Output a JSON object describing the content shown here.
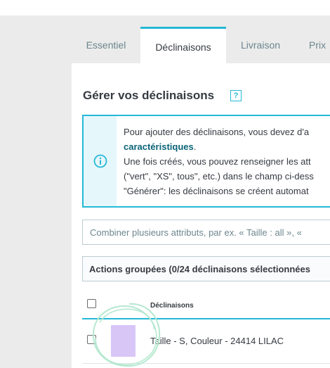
{
  "tabs": [
    {
      "label": "Essentiel"
    },
    {
      "label": "Déclinaisons",
      "active": true
    },
    {
      "label": "Livraison"
    },
    {
      "label": "Prix"
    }
  ],
  "section": {
    "title": "Gérer vos déclinaisons",
    "help_icon": "?"
  },
  "alert": {
    "icon": "info-icon",
    "line1": "Pour ajouter des déclinaisons, vous devez d'a",
    "line2_link": "caractéristiques",
    "line2_rest": ".",
    "line3": "Une fois créés, vous pouvez renseigner les att",
    "line4": "(\"vert\", \"XS\", tous\", etc.) dans le champ ci-dess",
    "line5": "\"Générer\": les déclinaisons se créent automat"
  },
  "combine_input": {
    "placeholder": "Combiner plusieurs attributs, par ex. « Taille : all », « "
  },
  "bulk_actions": {
    "label": "Actions groupées (0/24 déclinaisons sélectionnées"
  },
  "table": {
    "column_header": "Déclinaisons",
    "rows": [
      {
        "label": "Taille - S, Couleur - 24414 LILAC",
        "swatch_color": "#d8c6f7"
      }
    ]
  },
  "colors": {
    "accent": "#25b9d7",
    "alert_bg": "#e6f7fb",
    "link": "#0a6478"
  }
}
